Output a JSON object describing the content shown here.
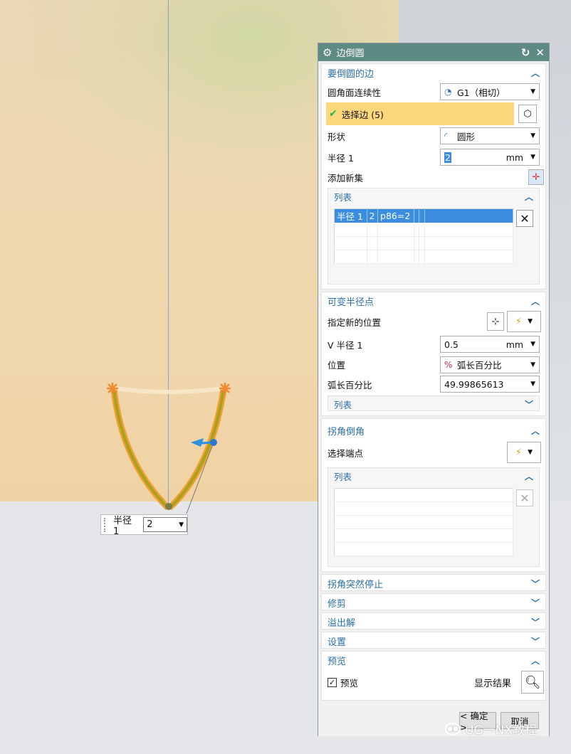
{
  "dialog": {
    "title": "边倒圆",
    "sections": {
      "edges": {
        "header": "要倒圆的边",
        "continuity_label": "圆角面连续性",
        "continuity_value": "G1（相切）",
        "select_label": "选择边 (5)",
        "shape_label": "形状",
        "shape_value": "圆形",
        "radius_label": "半径 1",
        "radius_value": "2",
        "radius_unit": "mm",
        "add_new_set_label": "添加新集",
        "list": {
          "header": "列表",
          "rows": [
            [
              "半径 1",
              "2",
              "p86=2",
              "",
              "",
              ""
            ],
            [
              "",
              "",
              "",
              "",
              "",
              ""
            ],
            [
              "",
              "",
              "",
              "",
              "",
              ""
            ],
            [
              "",
              "",
              "",
              "",
              "",
              ""
            ]
          ]
        }
      },
      "variable_radius": {
        "header": "可变半径点",
        "specify_location_label": "指定新的位置",
        "v_radius_label": "V 半径 1",
        "v_radius_value": "0.5",
        "v_radius_unit": "mm",
        "position_label": "位置",
        "position_value": "弧长百分比",
        "arc_percent_label": "弧长百分比",
        "arc_percent_value": "49.99865613",
        "list_header": "列表"
      },
      "corner_setback": {
        "header": "拐角倒角",
        "select_end_point_label": "选择端点",
        "list_header": "列表",
        "rows": 5
      },
      "corner_stop": {
        "header": "拐角突然停止"
      },
      "trim": {
        "header": "修剪"
      },
      "overflow": {
        "header": "溢出解"
      },
      "settings": {
        "header": "设置"
      },
      "preview": {
        "header": "预览",
        "checkbox_label": "预览",
        "checked": true,
        "show_result_label": "显示结果"
      }
    },
    "buttons": {
      "ok": "< 确定 >",
      "cancel": "取消"
    }
  },
  "onscreen_input": {
    "label": "半径 1",
    "value": "2"
  },
  "watermark": "UG一NX教程",
  "colors": {
    "title_bar": "#5d8a82",
    "section_header_text": "#2a6fa6",
    "selection_highlight": "#fcd77c",
    "list_selected": "#3b8de0",
    "edge_highlight": "#f0a030"
  }
}
